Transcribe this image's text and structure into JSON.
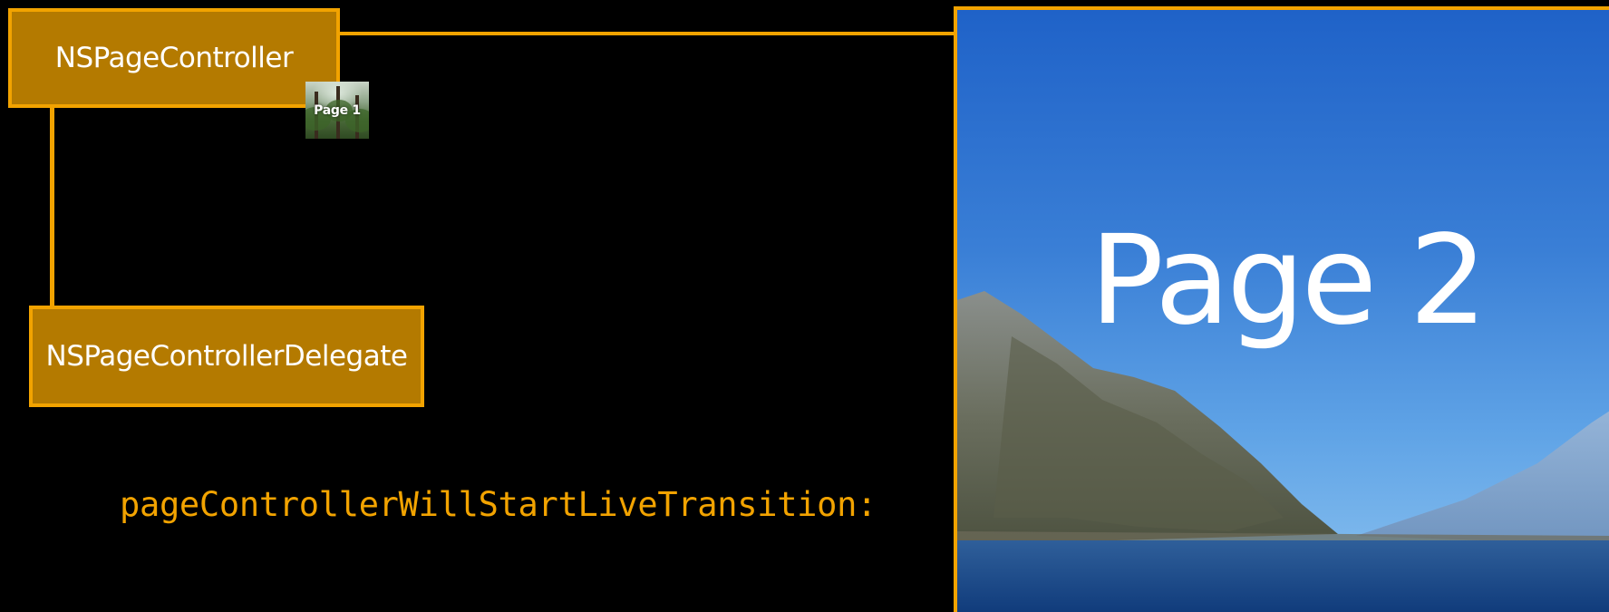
{
  "diagram": {
    "controller_label": "NSPageController",
    "delegate_label": "NSPageControllerDelegate",
    "method_label": "pageControllerWillStartLiveTransition:",
    "thumbnail_label": "Page 1",
    "current_page_label": "Page 2"
  },
  "colors": {
    "box_fill": "#b47a00",
    "box_border": "#f2a300",
    "connector": "#f2a300",
    "method_text": "#f2a300",
    "background": "#000000"
  }
}
